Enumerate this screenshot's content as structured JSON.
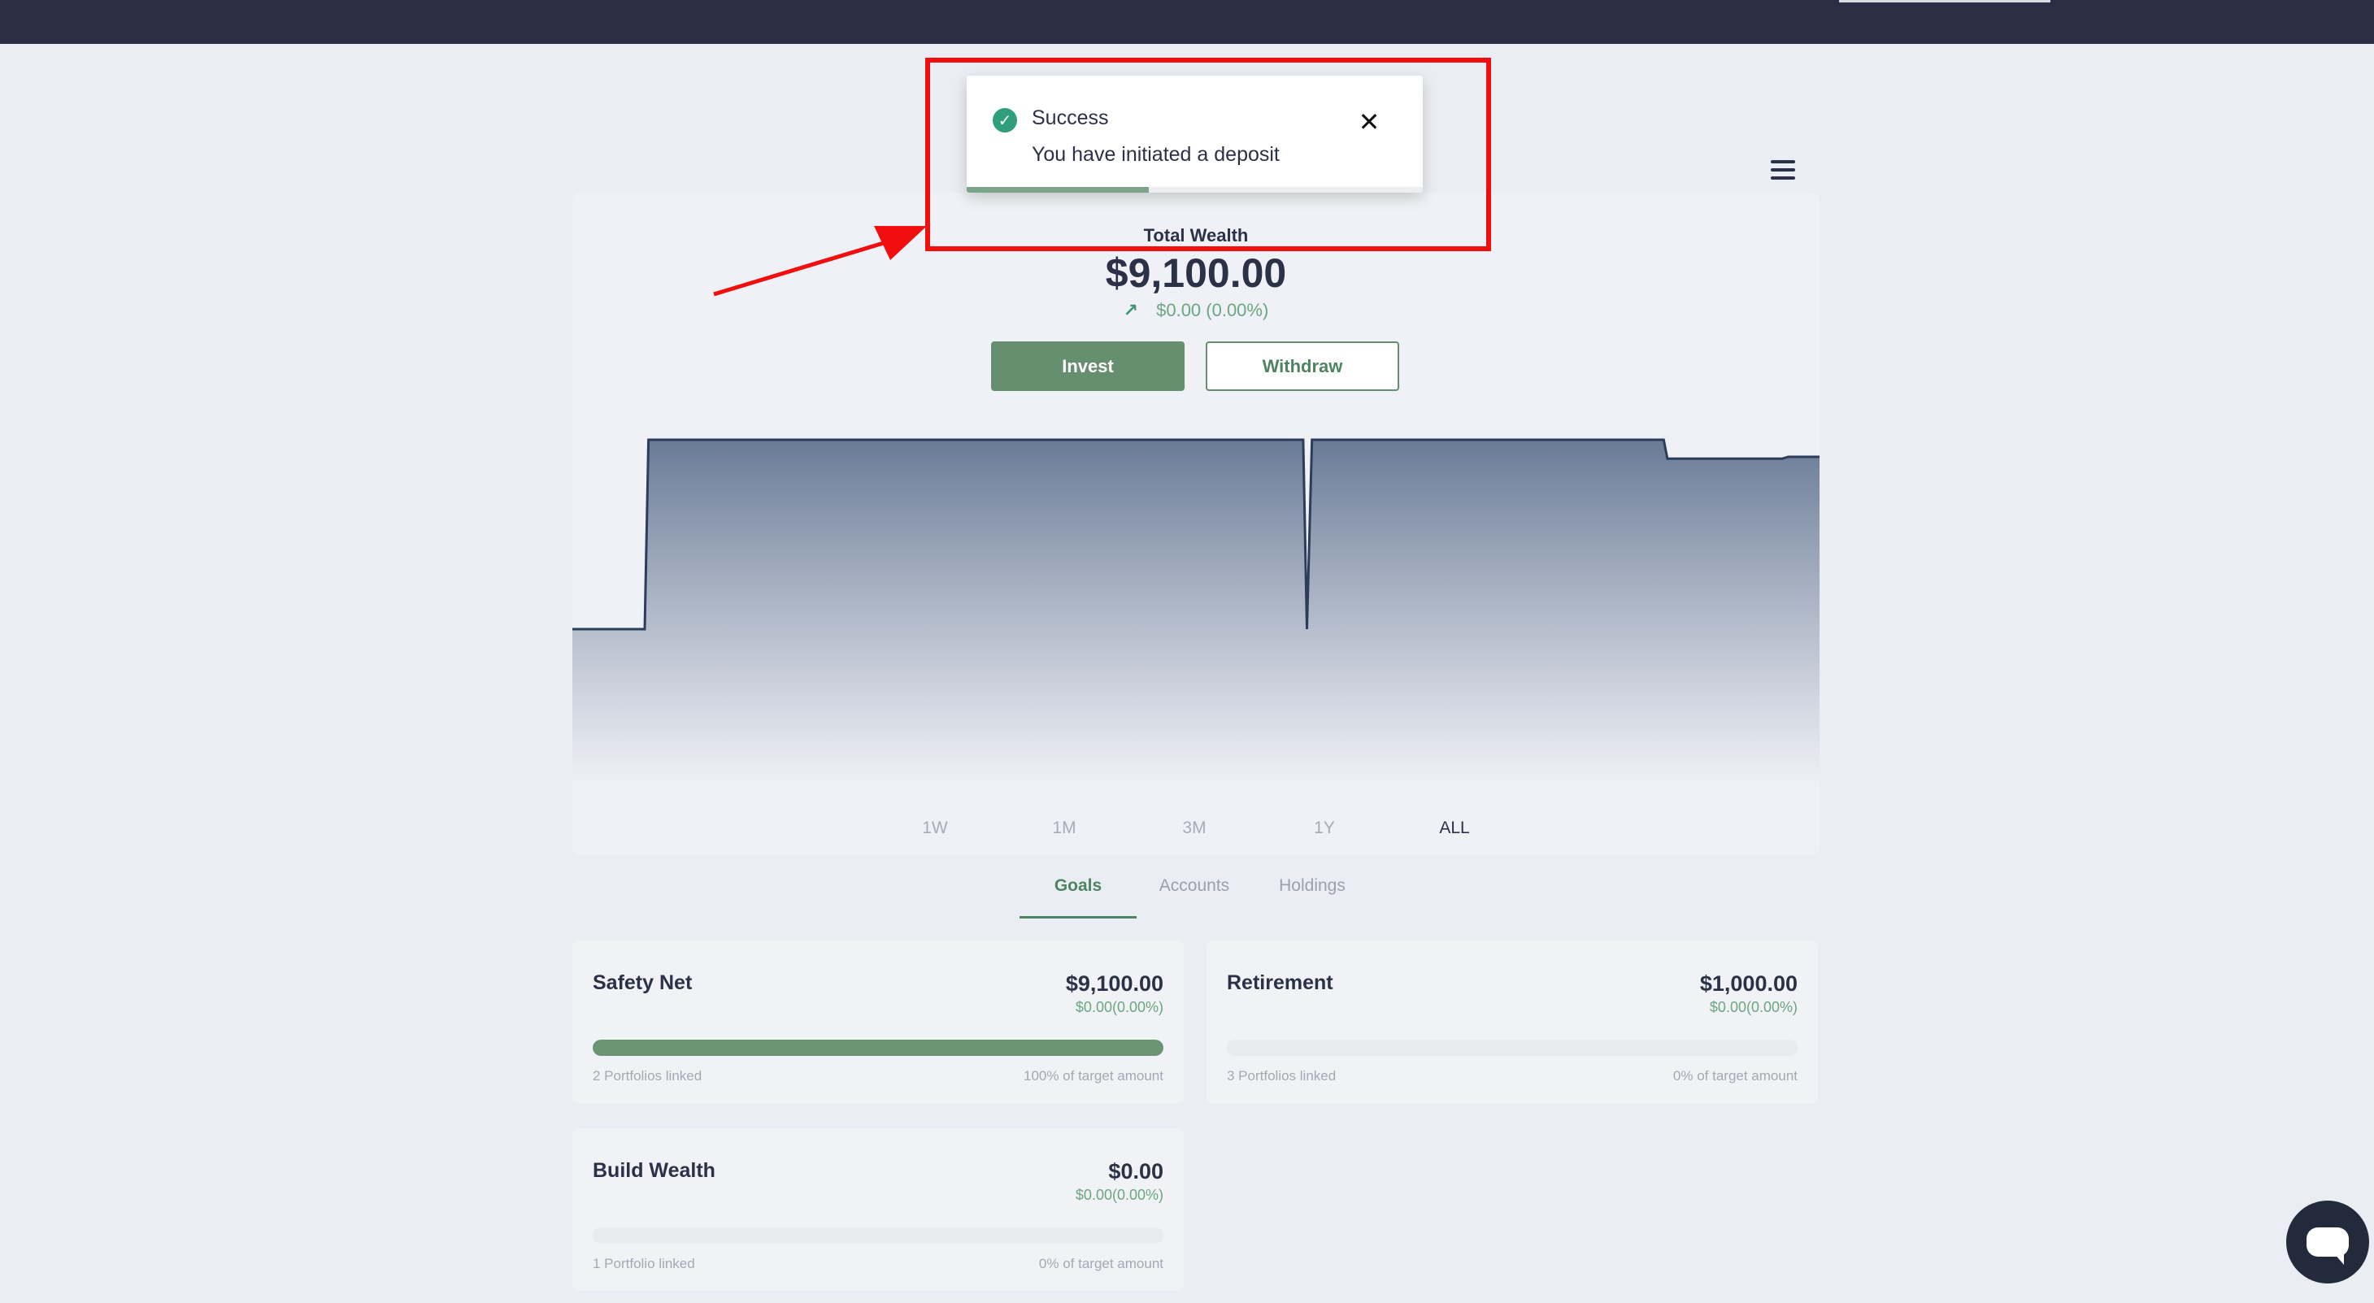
{
  "toast": {
    "title": "Success",
    "message": "You have initiated a deposit",
    "progress": 0.4
  },
  "wealth": {
    "label": "Total Wealth",
    "value": "$9,100.00",
    "change": "$0.00 (0.00%)",
    "invest_label": "Invest",
    "withdraw_label": "Withdraw"
  },
  "chart_data": {
    "type": "area",
    "title": "",
    "xlabel": "",
    "ylabel": "",
    "x": [
      0,
      0.058,
      0.061,
      0.586,
      0.589,
      0.593,
      0.875,
      0.878,
      0.97,
      0.975,
      1.0
    ],
    "values": [
      0.0,
      0.0,
      1.0,
      1.0,
      0.0,
      1.0,
      1.0,
      0.9,
      0.9,
      0.91,
      0.91
    ],
    "grid": false,
    "colors": {
      "line": "#2d3c5a",
      "fill_top": "#6a7b96",
      "fill_bottom": "#eff1f6"
    }
  },
  "ranges": [
    {
      "label": "1W",
      "active": false
    },
    {
      "label": "1M",
      "active": false
    },
    {
      "label": "3M",
      "active": false
    },
    {
      "label": "1Y",
      "active": false
    },
    {
      "label": "ALL",
      "active": true
    }
  ],
  "tabs": [
    {
      "label": "Goals",
      "active": true
    },
    {
      "label": "Accounts",
      "active": false
    },
    {
      "label": "Holdings",
      "active": false
    }
  ],
  "goals": [
    {
      "name": "Safety Net",
      "amount": "$9,100.00",
      "change": "$0.00(0.00%)",
      "linked": "2 Portfolios linked",
      "target": "100% of target amount",
      "progress": 1.0
    },
    {
      "name": "Retirement",
      "amount": "$1,000.00",
      "change": "$0.00(0.00%)",
      "linked": "3 Portfolios linked",
      "target": "0% of target amount",
      "progress": 0.0
    },
    {
      "name": "Build Wealth",
      "amount": "$0.00",
      "change": "$0.00(0.00%)",
      "linked": "1 Portfolio linked",
      "target": "0% of target amount",
      "progress": 0.0
    }
  ],
  "icons": {
    "toast": "check-circle-icon",
    "close": "close-icon",
    "menu": "hamburger-menu-icon",
    "change": "arrow-up-right-icon",
    "chat": "chat-bubble-icon"
  },
  "colors": {
    "topbar": "#2a2f45",
    "accent": "#668f6f",
    "positive": "#6aa782",
    "annotation": "#f00e0e"
  }
}
